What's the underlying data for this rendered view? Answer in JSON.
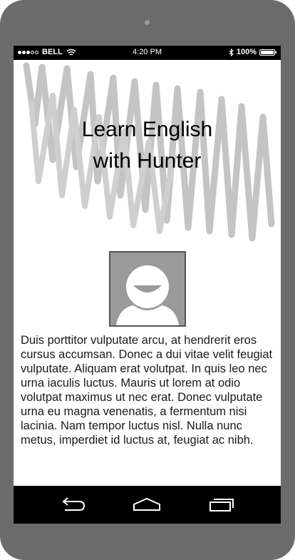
{
  "status_bar": {
    "carrier": "BELL",
    "time": "4:20 PM",
    "battery_percent": "100%",
    "battery_level": 1.0,
    "signal_dots_filled": 3,
    "signal_dots_total": 5
  },
  "hero": {
    "title_line1": "Learn English",
    "title_line2": "with Hunter"
  },
  "main": {
    "body": "Duis porttitor vulputate arcu, at hendrerit eros cursus accumsan. Donec a dui vitae velit feugiat vulputate. Aliquam erat volutpat. In quis leo nec urna iaculis luctus. Mauris ut lorem at odio volutpat maximus ut nec erat. Donec vulputate urna eu magna venenatis, a fermentum nisi lacinia. Nam tempor luctus nisl. Nulla nunc metus, imperdiet id luctus at, feugiat ac nibh."
  },
  "nav": {
    "back_icon": "back-icon",
    "home_icon": "home-icon",
    "recents_icon": "recents-icon"
  },
  "colors": {
    "device": "#6b6b6b",
    "scribble": "#c4c4c4",
    "avatar_bg": "#9a9a9a",
    "bar": "#000000"
  }
}
